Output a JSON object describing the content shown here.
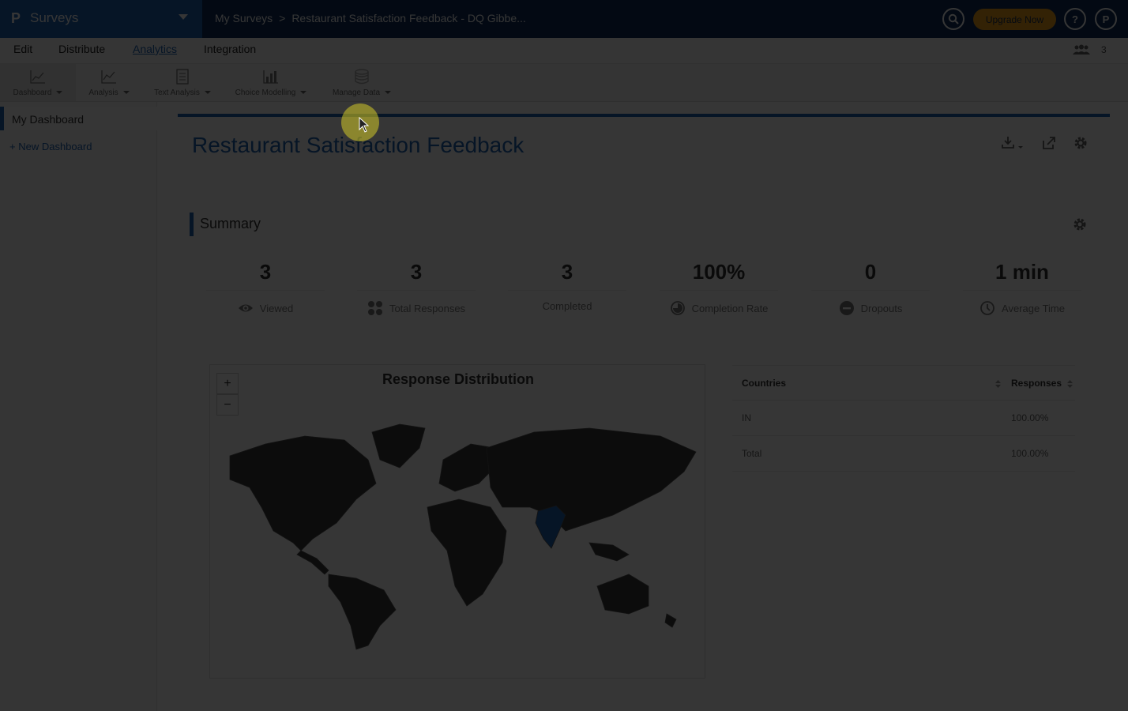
{
  "app": {
    "title": "Surveys",
    "logo": "P"
  },
  "breadcrumb": {
    "root": "My Surveys",
    "separator": ">",
    "current": "Restaurant Satisfaction Feedback - DQ Gibbe..."
  },
  "topbar": {
    "upgrade_label": "Upgrade Now",
    "help_label": "?",
    "user_initial": "P"
  },
  "tabs": [
    {
      "label": "Edit"
    },
    {
      "label": "Distribute"
    },
    {
      "label": "Analytics",
      "active": true
    },
    {
      "label": "Integration"
    }
  ],
  "collaborators": {
    "count": "3"
  },
  "toolbar": {
    "items": [
      {
        "label": "Dashboard",
        "icon": "chart-icon",
        "active": true
      },
      {
        "label": "Analysis",
        "icon": "line-chart-icon"
      },
      {
        "label": "Text Analysis",
        "icon": "document-icon"
      },
      {
        "label": "Choice Modelling",
        "icon": "bar-chart-icon"
      },
      {
        "label": "Manage Data",
        "icon": "database-icon"
      }
    ]
  },
  "sidebar": {
    "active_item": "My Dashboard",
    "new_item": "+ New Dashboard"
  },
  "dashboard": {
    "title": "Restaurant Satisfaction Feedback"
  },
  "summary": {
    "title": "Summary",
    "stats": [
      {
        "value": "3",
        "label": "Viewed",
        "icon": "eye-icon"
      },
      {
        "value": "3",
        "label": "Total Responses",
        "icon": "grid-dots-icon"
      },
      {
        "value": "3",
        "label": "Completed",
        "icon": ""
      },
      {
        "value": "100%",
        "label": "Completion Rate",
        "icon": "pie-icon"
      },
      {
        "value": "0",
        "label": "Dropouts",
        "icon": "minus-circle-icon"
      },
      {
        "value": "1 min",
        "label": "Average Time",
        "icon": "clock-icon"
      }
    ]
  },
  "map": {
    "title": "Response Distribution",
    "zoom_in": "+",
    "zoom_out": "−",
    "highlight_country": "IN",
    "highlight_color": "#1f62b4"
  },
  "table": {
    "headers": [
      "Countries",
      "Responses"
    ],
    "rows": [
      [
        "IN",
        "100.00%"
      ],
      [
        "Total",
        "100.00%"
      ]
    ]
  },
  "colors": {
    "brand": "#1f62b4",
    "topbar": "#0f2e5a",
    "accent": "#f2a11a"
  }
}
